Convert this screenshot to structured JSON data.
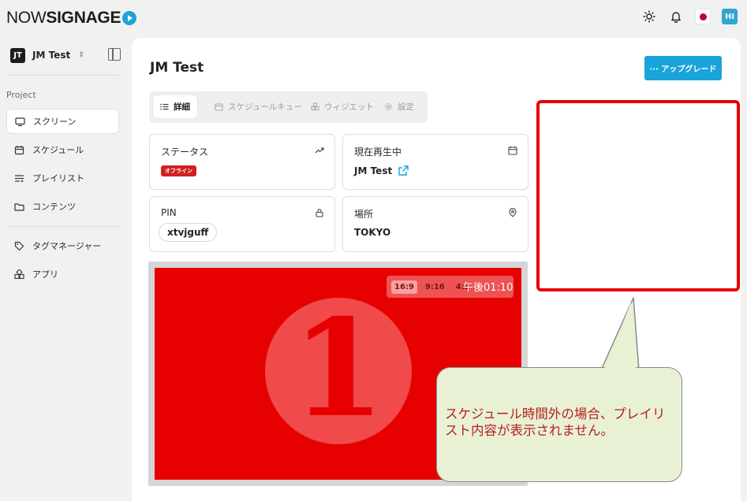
{
  "brand": {
    "logo_light": "NOW",
    "logo_bold": "SIGNAGE"
  },
  "topbar": {
    "theme_icon": "sun-icon",
    "notif_icon": "bell-icon",
    "flag": "jp-flag",
    "avatar_initials": "HI"
  },
  "sidebar": {
    "workspace": {
      "initials": "JT",
      "name": "JM Test"
    },
    "section_label": "Project",
    "items": [
      {
        "label": "スクリーン",
        "icon": "monitor-icon",
        "active": true
      },
      {
        "label": "スケジュール",
        "icon": "calendar-icon",
        "active": false
      },
      {
        "label": "プレイリスト",
        "icon": "playlist-icon",
        "active": false
      },
      {
        "label": "コンテンツ",
        "icon": "folder-icon",
        "active": false
      },
      {
        "label": "タグマネージャー",
        "icon": "tag-icon",
        "active": false
      },
      {
        "label": "アプリ",
        "icon": "apps-icon",
        "active": false
      }
    ]
  },
  "main": {
    "title": "JM Test",
    "upgrade_label": "··· アップグレード",
    "tabs": [
      {
        "label": "詳細",
        "active": true
      },
      {
        "label": "スケジュールキュー",
        "active": false
      },
      {
        "label": "ウィジエット",
        "active": false
      },
      {
        "label": "設定",
        "active": false
      }
    ],
    "cards": {
      "status": {
        "label": "ステータス",
        "badge": "オフライン"
      },
      "now_playing": {
        "label": "現在再生中",
        "value": "JM Test"
      },
      "pin": {
        "label": "PIN",
        "value": "xtvjguff"
      },
      "location": {
        "label": "場所",
        "value": "TOKYO"
      }
    },
    "preview": {
      "ratios": [
        "16:9",
        "9:16",
        "4:3"
      ],
      "selected_ratio": "16:9",
      "time": "午後01:10",
      "content_number": "1"
    }
  },
  "annotation": {
    "callout_text": "スケジュール時間外の場合、プレイリスト内容が表示されません。",
    "color": "#e60000",
    "callout_bg": "#e9f1d5"
  }
}
